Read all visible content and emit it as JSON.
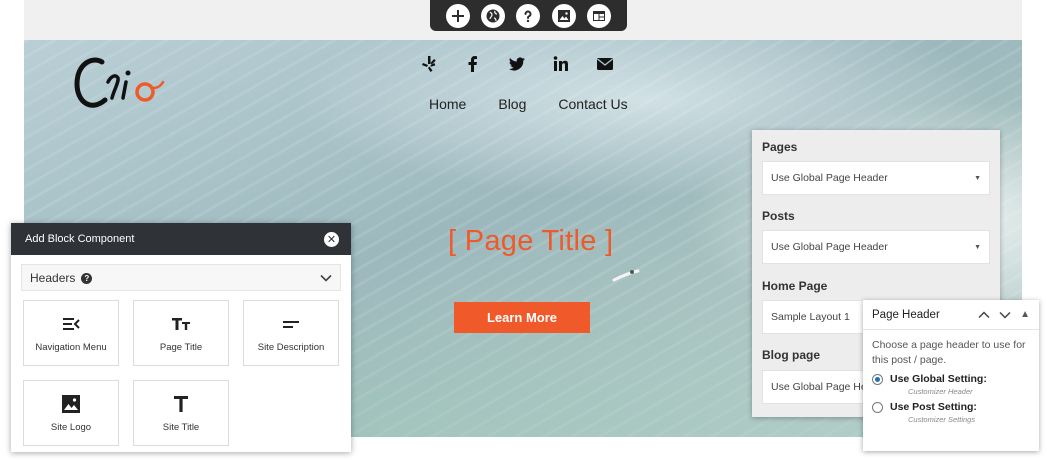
{
  "toolbar": {
    "buttons": [
      {
        "icon": "plus-icon"
      },
      {
        "icon": "globe-icon"
      },
      {
        "icon": "help-icon"
      },
      {
        "icon": "image-icon"
      },
      {
        "icon": "layout-icon"
      }
    ]
  },
  "header": {
    "logo_text": "Crio",
    "social": [
      "yelp-icon",
      "facebook-icon",
      "twitter-icon",
      "linkedin-icon",
      "envelope-icon"
    ],
    "nav": [
      {
        "label": "Home"
      },
      {
        "label": "Blog"
      },
      {
        "label": "Contact Us"
      }
    ]
  },
  "hero": {
    "page_title": "[ Page Title ]",
    "cta_label": "Learn More"
  },
  "block_panel": {
    "title": "Add Block Component",
    "section_label": "Headers",
    "components": [
      {
        "label": "Navigation Menu",
        "icon": "menu-icon"
      },
      {
        "label": "Page Title",
        "icon": "text-size-icon"
      },
      {
        "label": "Site Description",
        "icon": "short-text-icon"
      },
      {
        "label": "Site Logo",
        "icon": "image-icon"
      },
      {
        "label": "Site Title",
        "icon": "title-icon"
      }
    ]
  },
  "defaults_panel": {
    "groups": [
      {
        "label": "Pages",
        "value": "Use Global Page Header"
      },
      {
        "label": "Posts",
        "value": "Use Global Page Header"
      },
      {
        "label": "Home Page",
        "value": "Sample Layout 1"
      },
      {
        "label": "Blog page",
        "value": "Use Global Page Header"
      }
    ]
  },
  "page_header_box": {
    "title": "Page Header",
    "description": "Choose a page header to use for this post / page.",
    "options": [
      {
        "label": "Use Global Setting:",
        "sub": "Customizer Header",
        "selected": true
      },
      {
        "label": "Use Post Setting:",
        "sub": "Customizer Settings",
        "selected": false
      }
    ]
  },
  "colors": {
    "accent": "#f0592a",
    "toolbar": "#2d2d2d",
    "panel_header": "#2f3338"
  }
}
